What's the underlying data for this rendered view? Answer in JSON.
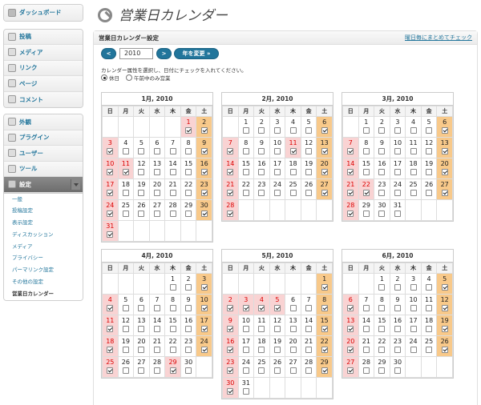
{
  "sidebar": {
    "dashboard": "ダッシュボード",
    "group1": [
      "投稿",
      "メディア",
      "リンク",
      "ページ",
      "コメント"
    ],
    "group2": [
      "外観",
      "プラグイン",
      "ユーザー",
      "ツール",
      "設定"
    ],
    "submenu": [
      "一般",
      "投稿設定",
      "表示設定",
      "ディスカッション",
      "メディア",
      "プライバシー",
      "パーマリンク設定",
      "その他の設定",
      "営業日カレンダー"
    ]
  },
  "header": {
    "title": "営業日カレンダー"
  },
  "panel": {
    "title": "営業日カレンダー設定",
    "link": "曜日毎にまとめてチェック"
  },
  "controls": {
    "prev": "<",
    "year": "2010",
    "next": ">",
    "change": "年を変更 »"
  },
  "help": "カレンダー属性を選択し、日付にチェックを入れてください。",
  "radios": [
    {
      "label": "休日",
      "selected": true
    },
    {
      "label": "午前中のみ営業",
      "selected": false
    }
  ],
  "weekdays": [
    "日",
    "月",
    "火",
    "水",
    "木",
    "金",
    "土"
  ],
  "months": [
    {
      "label": "1月, 2010",
      "start": 5,
      "days": 31,
      "holidays": [
        1,
        2,
        3,
        9,
        10,
        11,
        16,
        17,
        23,
        24,
        30,
        31
      ]
    },
    {
      "label": "2月, 2010",
      "start": 1,
      "days": 28,
      "holidays": [
        6,
        7,
        11,
        13,
        14,
        20,
        21,
        27,
        28
      ]
    },
    {
      "label": "3月, 2010",
      "start": 1,
      "days": 31,
      "holidays": [
        6,
        7,
        13,
        14,
        20,
        21,
        22,
        27,
        28
      ]
    },
    {
      "label": "4月, 2010",
      "start": 4,
      "days": 30,
      "holidays": [
        3,
        4,
        10,
        11,
        17,
        18,
        24,
        25,
        29
      ]
    },
    {
      "label": "5月, 2010",
      "start": 6,
      "days": 31,
      "holidays": [
        1,
        2,
        3,
        4,
        5,
        8,
        9,
        15,
        16,
        22,
        23,
        29,
        30
      ]
    },
    {
      "label": "6月, 2010",
      "start": 2,
      "days": 30,
      "holidays": [
        5,
        6,
        12,
        13,
        19,
        20,
        26,
        27
      ]
    }
  ],
  "colors": {
    "holiday_bg": "#f9d3d3",
    "saturday_bg": "#f8c98a",
    "holiday_text": "#dd0000",
    "accent": "#21759b"
  }
}
